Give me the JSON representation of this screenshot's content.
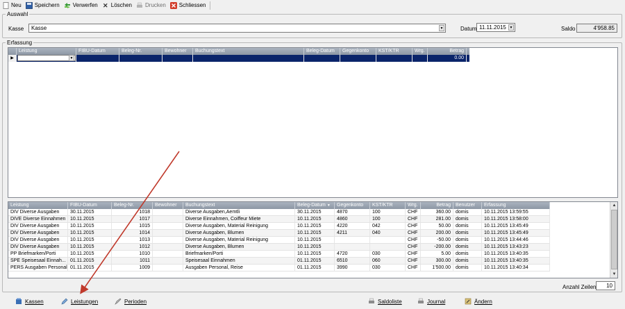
{
  "toolbar": {
    "items": [
      {
        "label": "Neu",
        "icon": "new-document-icon",
        "enabled": true
      },
      {
        "label": "Speichern",
        "icon": "save-disk-icon",
        "enabled": true
      },
      {
        "label": "Verwerfen",
        "icon": "discard-arrows-icon",
        "enabled": true
      },
      {
        "label": "Löschen",
        "icon": "delete-x-icon",
        "enabled": true
      },
      {
        "label": "Drucken",
        "icon": "printer-icon",
        "enabled": false
      },
      {
        "label": "Schliessen",
        "icon": "close-red-x-icon",
        "enabled": true
      }
    ]
  },
  "auswahl": {
    "legend": "Auswahl",
    "kasse_label": "Kasse",
    "kasse_value": "Kasse",
    "datum_label": "Datum",
    "datum_value": "11.11.2015",
    "saldo_label": "Saldo",
    "saldo_value": "4'958.85"
  },
  "erfassung": {
    "legend": "Erfassung",
    "columns": [
      "Leistung",
      "FIBU-Datum",
      "Beleg-Nr.",
      "Bewohner",
      "Buchungstext",
      "Beleg-Datum",
      "Gegenkonto",
      "KST/KTR",
      "Wrg.",
      "Betrag"
    ],
    "new_row_betrag": "0.00"
  },
  "journal": {
    "columns": [
      "Leistung",
      "FIBU-Datum",
      "Beleg-Nr.",
      "Bewohner",
      "Buchungstext",
      "Beleg-Datum",
      "Gegenkonto",
      "KST/KTR",
      "Wrg.",
      "Betrag",
      "Benutzer",
      "Erfassung"
    ],
    "rows": [
      {
        "leistung": "DIV Diverse Ausgaben",
        "fibu": "30.11.2015",
        "beleg": "1018",
        "bewohner": "",
        "text": "Diverse Ausgaben,Aemtli",
        "belegdatum": "30.11.2015",
        "gegenkonto": "4870",
        "kst": "100",
        "wrg": "CHF",
        "betrag": "360.00",
        "benutzer": "domis",
        "erfassung": "10.11.2015 13:59:55"
      },
      {
        "leistung": "DIVE Diverse Einnahmen",
        "fibu": "10.11.2015",
        "beleg": "1017",
        "bewohner": "",
        "text": "Diverse Einnahmen, Coiffeur Miete",
        "belegdatum": "10.11.2015",
        "gegenkonto": "4860",
        "kst": "100",
        "wrg": "CHF",
        "betrag": "281.00",
        "benutzer": "domis",
        "erfassung": "10.11.2015 13:58:00"
      },
      {
        "leistung": "DIV Diverse Ausgaben",
        "fibu": "10.11.2015",
        "beleg": "1015",
        "bewohner": "",
        "text": "Diverse Ausgaben, Material Reinigung",
        "belegdatum": "10.11.2015",
        "gegenkonto": "4220",
        "kst": "042",
        "wrg": "CHF",
        "betrag": "50.00",
        "benutzer": "domis",
        "erfassung": "10.11.2015 13:45:49"
      },
      {
        "leistung": "DIV Diverse Ausgaben",
        "fibu": "10.11.2015",
        "beleg": "1014",
        "bewohner": "",
        "text": "Diverse Ausgaben, Blumen",
        "belegdatum": "10.11.2015",
        "gegenkonto": "4211",
        "kst": "040",
        "wrg": "CHF",
        "betrag": "200.00",
        "benutzer": "domis",
        "erfassung": "10.11.2015 13:45:49"
      },
      {
        "leistung": "DIV Diverse Ausgaben",
        "fibu": "10.11.2015",
        "beleg": "1013",
        "bewohner": "",
        "text": "Diverse Ausgaben, Material Reinigung",
        "belegdatum": "10.11.2015",
        "gegenkonto": "",
        "kst": "",
        "wrg": "CHF",
        "betrag": "-50.00",
        "benutzer": "domis",
        "erfassung": "10.11.2015 13:44:46"
      },
      {
        "leistung": "DIV Diverse Ausgaben",
        "fibu": "10.11.2015",
        "beleg": "1012",
        "bewohner": "",
        "text": "Diverse Ausgaben, Blumen",
        "belegdatum": "10.11.2015",
        "gegenkonto": "",
        "kst": "",
        "wrg": "CHF",
        "betrag": "-200.00",
        "benutzer": "domis",
        "erfassung": "10.11.2015 13:43:23"
      },
      {
        "leistung": "PP Briefmarken/Porti",
        "fibu": "10.11.2015",
        "beleg": "1010",
        "bewohner": "",
        "text": "Briefmarken/Porti",
        "belegdatum": "10.11.2015",
        "gegenkonto": "4720",
        "kst": "030",
        "wrg": "CHF",
        "betrag": "5.00",
        "benutzer": "domis",
        "erfassung": "10.11.2015 13:40:35"
      },
      {
        "leistung": "SPE Speisesaal Einnah...",
        "fibu": "01.11.2015",
        "beleg": "1011",
        "bewohner": "",
        "text": "Speisesaal Einnahmen",
        "belegdatum": "01.11.2015",
        "gegenkonto": "6510",
        "kst": "060",
        "wrg": "CHF",
        "betrag": "300.00",
        "benutzer": "domis",
        "erfassung": "10.11.2015 13:40:35"
      },
      {
        "leistung": "PERS Ausgaben Personal",
        "fibu": "01.11.2015",
        "beleg": "1009",
        "bewohner": "",
        "text": "Ausgaben Personal, Reise",
        "belegdatum": "01.11.2015",
        "gegenkonto": "3990",
        "kst": "030",
        "wrg": "CHF",
        "betrag": "1'500.00",
        "benutzer": "domis",
        "erfassung": "10.11.2015 13:40:34"
      }
    ],
    "anzahl_label": "Anzahl Zeilen",
    "anzahl_value": "10"
  },
  "bottom": {
    "left": [
      {
        "label": "Kassen",
        "icon": "cashbox-icon"
      },
      {
        "label": "Leistungen",
        "icon": "pencil-icon"
      },
      {
        "label": "Perioden",
        "icon": "periods-icon"
      }
    ],
    "right": [
      {
        "label": "Saldoliste",
        "icon": "printer-icon"
      },
      {
        "label": "Journal",
        "icon": "printer-icon"
      },
      {
        "label": "Ändern",
        "icon": "edit-icon"
      }
    ]
  },
  "colors": {
    "annotation_arrow": "#c0392b",
    "selected_row": "#0a246a"
  }
}
